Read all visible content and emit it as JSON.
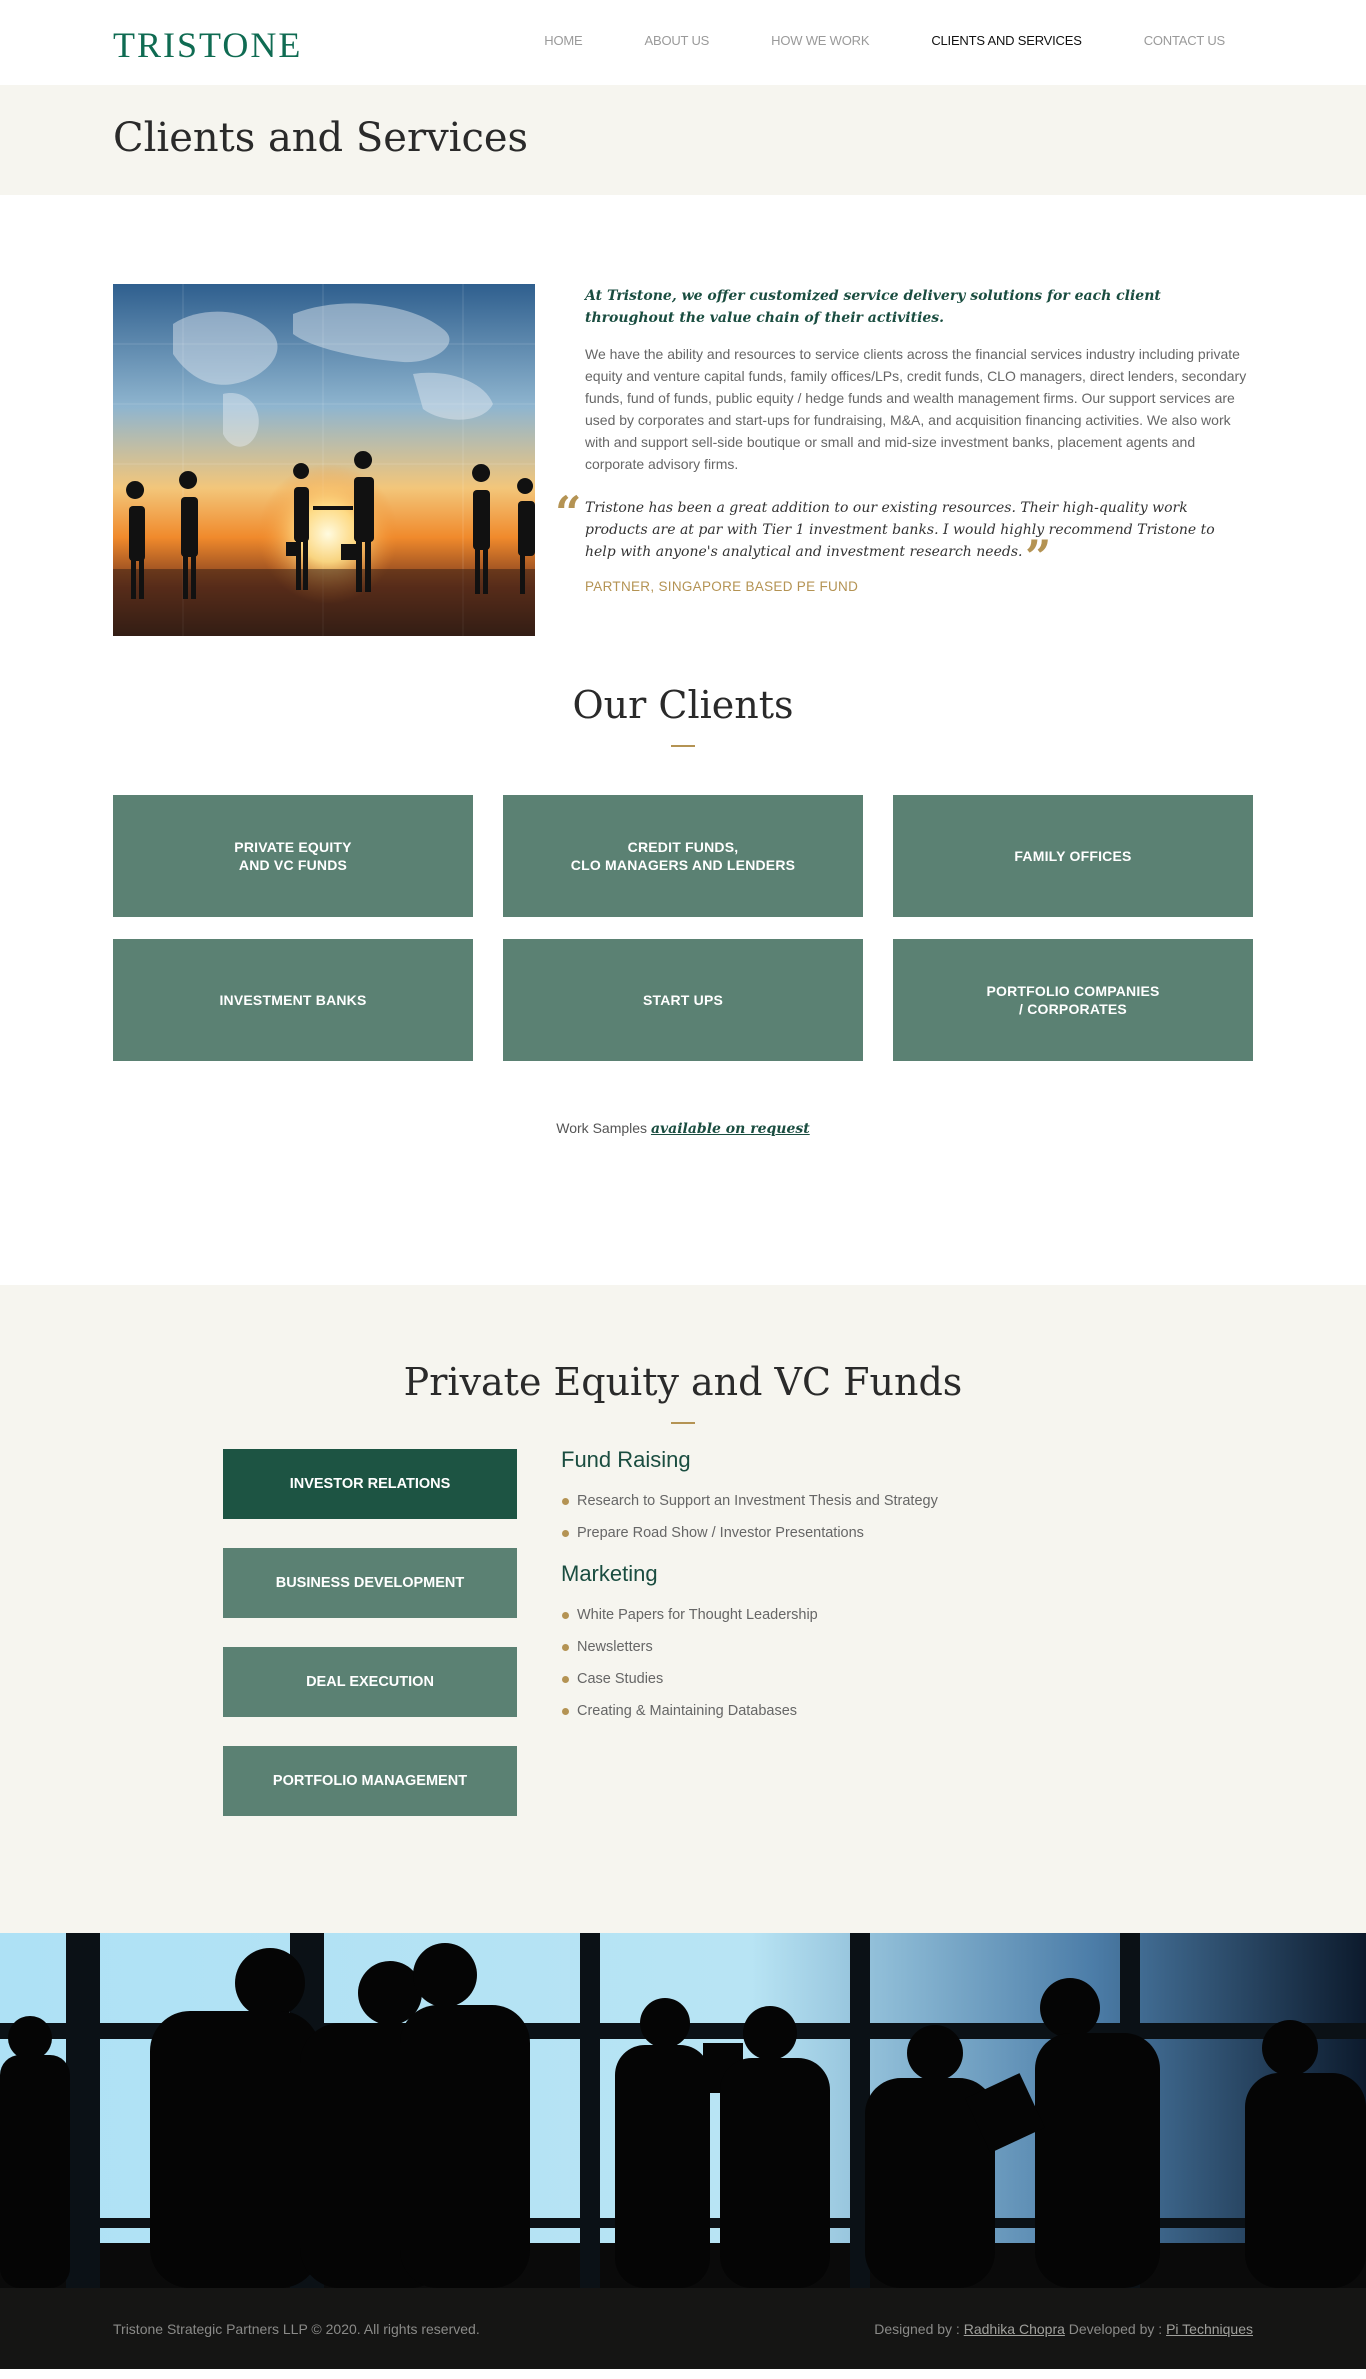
{
  "header": {
    "logo": "TRISTONE",
    "nav": [
      {
        "label": "HOME"
      },
      {
        "label": "ABOUT US"
      },
      {
        "label": "HOW WE WORK"
      },
      {
        "label": "CLIENTS AND SERVICES"
      },
      {
        "label": "CONTACT US"
      }
    ],
    "active_nav": "CLIENTS AND SERVICES"
  },
  "page_title": "Clients and Services",
  "intro": {
    "lead": "At Tristone, we offer customized service delivery solutions for each client throughout the value chain of their activities.",
    "paragraph": "We have the ability and resources to service clients across the financial services industry including private equity and venture capital funds, family offices/LPs, credit funds, CLO managers, direct lenders, secondary funds, fund of funds, public equity / hedge funds and wealth management firms. Our support services are used by corporates and start-ups for fundraising, M&A, and acquisition financing activities. We also work with and support sell-side boutique or small and mid-size investment banks, placement agents and corporate advisory firms.",
    "quote": "Tristone has been a great addition to our existing resources. Their high-quality work products are at par with Tier 1 investment banks. I would highly recommend Tristone to help with anyone's analytical and investment research needs.",
    "quote_author": "PARTNER, SINGAPORE BASED PE FUND"
  },
  "clients": {
    "title": "Our Clients",
    "tiles": [
      {
        "label": "PRIVATE EQUITY\nAND VC FUNDS"
      },
      {
        "label": "CREDIT FUNDS,\nCLO MANAGERS AND LENDERS"
      },
      {
        "label": "FAMILY OFFICES"
      },
      {
        "label": "INVESTMENT BANKS"
      },
      {
        "label": "START UPS"
      },
      {
        "label": "PORTFOLIO COMPANIES\n/ CORPORATES"
      }
    ],
    "work_samples_prefix": "Work Samples",
    "work_samples_link": "available on request"
  },
  "services": {
    "title": "Private Equity and VC Funds",
    "tabs": [
      {
        "label": "INVESTOR RELATIONS",
        "active": true
      },
      {
        "label": "BUSINESS DEVELOPMENT",
        "active": false
      },
      {
        "label": "DEAL EXECUTION",
        "active": false
      },
      {
        "label": "PORTFOLIO MANAGEMENT",
        "active": false
      }
    ],
    "groups": [
      {
        "heading": "Fund Raising",
        "items": [
          "Research to Support an Investment Thesis and Strategy",
          "Prepare Road Show / Investor Presentations"
        ]
      },
      {
        "heading": "Marketing",
        "items": [
          "White Papers for Thought Leadership",
          "Newsletters",
          "Case Studies",
          "Creating & Maintaining Databases"
        ]
      }
    ]
  },
  "footer": {
    "copyright": "Tristone Strategic Partners LLP © 2020. All rights reserved.",
    "designed_prefix": "Designed by :",
    "designer": "Radhika Chopra",
    "developed_prefix": "Developed by :",
    "developer": "Pi Techniques"
  },
  "colors": {
    "brand_green": "#0f6b52",
    "tile_green": "#5b8173",
    "tile_active": "#1d5443",
    "gold": "#b49353",
    "cream": "#f6f5ef"
  }
}
